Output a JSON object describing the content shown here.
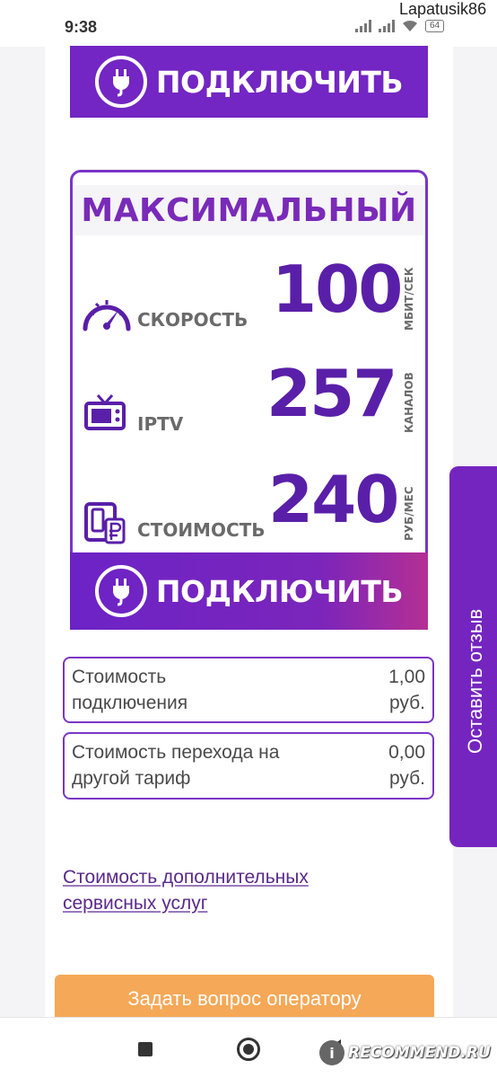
{
  "status_bar": {
    "time": "9:38",
    "user": "Lapatusik86",
    "battery": "64"
  },
  "connect_button": {
    "label": "ПОДКЛЮЧИТЬ"
  },
  "tariff": {
    "name": "МАКСИМАЛЬНЫЙ",
    "metrics": [
      {
        "icon": "speedometer-icon",
        "label": "СКОРОСТЬ",
        "value": "100",
        "unit": "МБИТ/СЕК"
      },
      {
        "icon": "tv-icon",
        "label": "IPTV",
        "value": "257",
        "unit": "КАНАЛОВ"
      },
      {
        "icon": "wallet-ruble-icon",
        "label": "СТОИМОСТЬ",
        "value": "240",
        "unit": "РУБ/МЕС"
      }
    ]
  },
  "fees": [
    {
      "label_line1": "Стоимость",
      "label_line2": "подключения",
      "value_line1": "1,00",
      "value_line2": "руб."
    },
    {
      "label_line1": "Стоимость перехода на",
      "label_line2": "другой тариф",
      "value_line1": "0,00",
      "value_line2": "руб."
    }
  ],
  "services_link": {
    "line1": "Стоимость дополнительных",
    "line2": "сервисных услуг"
  },
  "ask_operator_button": "Задать вопрос оператору",
  "review_tab": "Оставить отзыв",
  "watermark": "RECOMMEND.RU",
  "colors": {
    "brand_purple": "#7326c3",
    "value_purple": "#5a1fa8",
    "ask_button_orange": "#f5a857"
  }
}
